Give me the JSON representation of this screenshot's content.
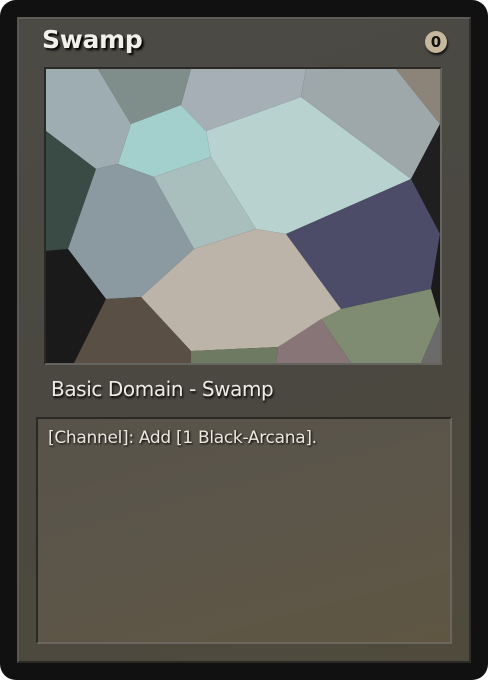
{
  "card": {
    "name": "Swamp",
    "cost": "0",
    "type_line": "Basic Domain - Swamp",
    "rules_text": "[Channel]: Add [1 Black-Arcana].",
    "art": {
      "icon": "abstract-voronoi-artwork",
      "colors": {
        "pale_slate": "#9eadb2",
        "sage_grey": "#7f8e8b",
        "cloud_grey": "#a6afb5",
        "silver_grey": "#9ea7a9",
        "taupe": "#8d8479",
        "deep_green": "#3a4a44",
        "mint": "#a3cfcc",
        "steel_blue": "#8b9aa1",
        "pale_teal": "#a9bfbe",
        "sea_mint": "#b7d2cf",
        "charcoal": "#1f1f1f",
        "slate_indigo": "#4c4c68",
        "near_black": "#1a1a1a",
        "sand_beige": "#bcb4a9",
        "dark_brown": "#5a4f45",
        "moss": "#7f8c71",
        "olive_green": "#6e7a61",
        "mauve": "#877578",
        "ash": "#6b6b6b"
      }
    }
  }
}
